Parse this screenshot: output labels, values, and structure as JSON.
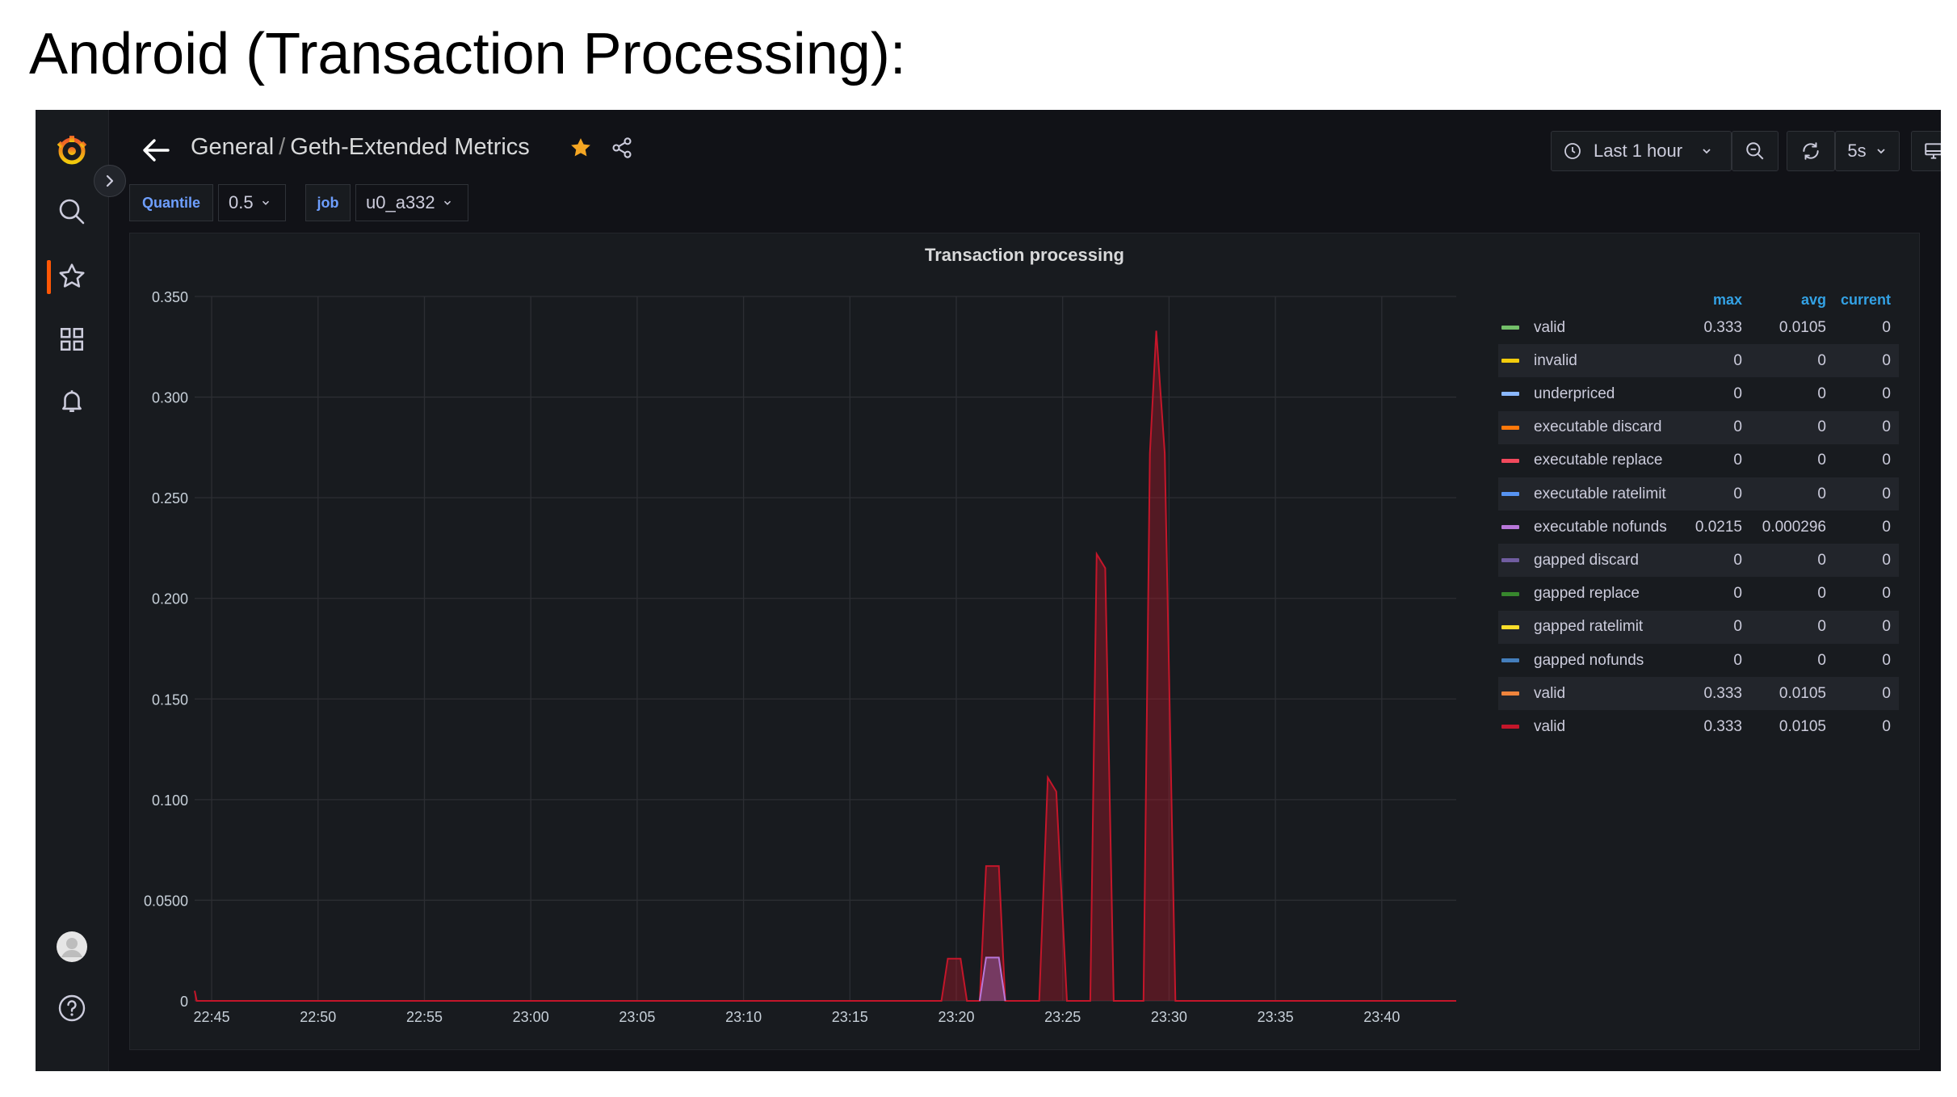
{
  "slide_title": "Android (Transaction Processing):",
  "breadcrumb": {
    "folder": "General",
    "separator": "/",
    "dashboard": "Geth-Extended Metrics"
  },
  "toolbar": {
    "time_range": "Last 1 hour",
    "refresh_interval": "5s"
  },
  "variables": [
    {
      "label": "Quantile",
      "value": "0.5"
    },
    {
      "label": "job",
      "value": "u0_a332"
    }
  ],
  "panel": {
    "title": "Transaction processing"
  },
  "legend": {
    "headers": {
      "max": "max",
      "avg": "avg",
      "current": "current"
    },
    "rows": [
      {
        "name": "valid",
        "color": "#73bf69",
        "max": "0.333",
        "avg": "0.0105",
        "current": "0"
      },
      {
        "name": "invalid",
        "color": "#f2cc0c",
        "max": "0",
        "avg": "0",
        "current": "0"
      },
      {
        "name": "underpriced",
        "color": "#8ab8ff",
        "max": "0",
        "avg": "0",
        "current": "0"
      },
      {
        "name": "executable discard",
        "color": "#ff780a",
        "max": "0",
        "avg": "0",
        "current": "0"
      },
      {
        "name": "executable replace",
        "color": "#f2495c",
        "max": "0",
        "avg": "0",
        "current": "0"
      },
      {
        "name": "executable ratelimit",
        "color": "#5794f2",
        "max": "0",
        "avg": "0",
        "current": "0"
      },
      {
        "name": "executable nofunds",
        "color": "#b877d9",
        "max": "0.0215",
        "avg": "0.000296",
        "current": "0"
      },
      {
        "name": "gapped discard",
        "color": "#705da0",
        "max": "0",
        "avg": "0",
        "current": "0"
      },
      {
        "name": "gapped replace",
        "color": "#37872d",
        "max": "0",
        "avg": "0",
        "current": "0"
      },
      {
        "name": "gapped ratelimit",
        "color": "#fade2a",
        "max": "0",
        "avg": "0",
        "current": "0"
      },
      {
        "name": "gapped nofunds",
        "color": "#447ebc",
        "max": "0",
        "avg": "0",
        "current": "0"
      },
      {
        "name": "valid",
        "color": "#ef843c",
        "max": "0.333",
        "avg": "0.0105",
        "current": "0"
      },
      {
        "name": "valid",
        "color": "#c4162a",
        "max": "0.333",
        "avg": "0.0105",
        "current": "0"
      }
    ]
  },
  "chart_data": {
    "type": "area",
    "title": "Transaction processing",
    "xlabel": "",
    "ylabel": "",
    "x_ticks": [
      "22:45",
      "22:50",
      "22:55",
      "23:00",
      "23:05",
      "23:10",
      "23:15",
      "23:20",
      "23:25",
      "23:30",
      "23:35",
      "23:40"
    ],
    "y_ticks": [
      "0",
      "0.0500",
      "0.100",
      "0.150",
      "0.200",
      "0.250",
      "0.300",
      "0.350"
    ],
    "ylim": [
      0,
      0.35
    ],
    "xlim_minutes": [
      -0.8,
      58.5
    ],
    "grid": true,
    "legend_position": "right",
    "series": [
      {
        "name": "valid",
        "color": "#c4162a",
        "points": [
          [
            -0.8,
            0.005
          ],
          [
            -0.7,
            0
          ],
          [
            34.3,
            0
          ],
          [
            34.6,
            0.021
          ],
          [
            35.2,
            0.021
          ],
          [
            35.5,
            0
          ],
          [
            36.1,
            0
          ],
          [
            36.4,
            0.067
          ],
          [
            37.0,
            0.067
          ],
          [
            37.3,
            0
          ],
          [
            38.9,
            0
          ],
          [
            39.3,
            0.111
          ],
          [
            39.7,
            0.104
          ],
          [
            40.2,
            0
          ],
          [
            41.3,
            0
          ],
          [
            41.6,
            0.222
          ],
          [
            42.0,
            0.215
          ],
          [
            42.4,
            0
          ],
          [
            43.8,
            0
          ],
          [
            44.1,
            0.272
          ],
          [
            44.4,
            0.333
          ],
          [
            44.8,
            0.272
          ],
          [
            45.3,
            0
          ],
          [
            58.5,
            0
          ]
        ]
      },
      {
        "name": "executable nofunds",
        "color": "#b877d9",
        "points": [
          [
            36.1,
            0
          ],
          [
            36.4,
            0.0215
          ],
          [
            37.0,
            0.0215
          ],
          [
            37.3,
            0
          ]
        ]
      }
    ]
  }
}
